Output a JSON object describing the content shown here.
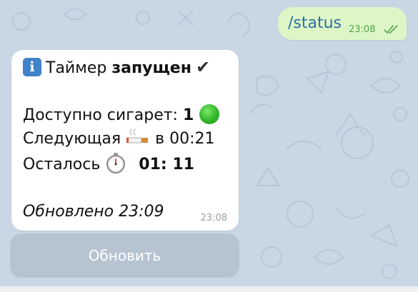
{
  "colors": {
    "wallpaper": "#c9d6e3",
    "outgoing_bubble": "#dcf7c5",
    "incoming_bubble": "#ffffff",
    "command_text": "#2f6ea5",
    "keyboard_button": "#b6c4d1"
  },
  "outgoing": {
    "text": "/status",
    "time": "23:08",
    "status_icon": "double-check-icon"
  },
  "incoming": {
    "info_icon": "i",
    "line1_prefix": "Таймер ",
    "line1_bold": "запущен",
    "line1_check": "✔",
    "line2_label": "Доступно сигарет: ",
    "line2_value": "1",
    "line2_icon": "green-circle-icon",
    "line3_label": "Следующая",
    "line3_icon": "cigarette-icon",
    "line3_value": "в 00:21",
    "line4_label": "Осталось",
    "line4_icon": "stopwatch-icon",
    "line4_value": "01: 11",
    "line5": "Обновлено 23:09",
    "time": "23:08"
  },
  "keyboard": {
    "button_label": "Обновить"
  }
}
